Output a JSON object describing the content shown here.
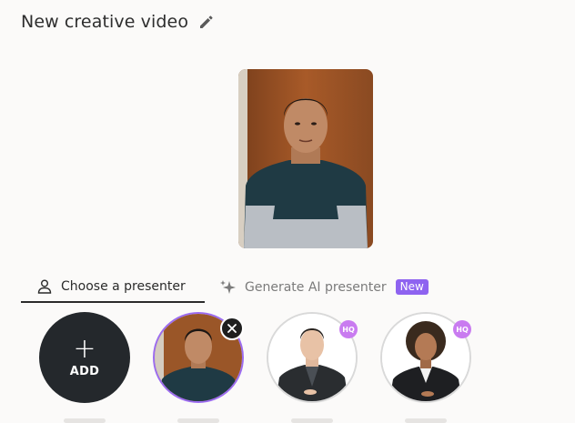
{
  "header": {
    "title": "New creative video",
    "edit_icon": "pencil-icon"
  },
  "preview": {
    "alt": "Selected presenter preview"
  },
  "tabs": [
    {
      "label": "Choose a presenter",
      "icon": "person-outline-icon",
      "active": true
    },
    {
      "label": "Generate AI presenter",
      "icon": "sparkles-icon",
      "badge": "New",
      "active": false
    }
  ],
  "presenters": {
    "add_label": "ADD",
    "items": [
      {
        "name": "custom-uploaded-presenter",
        "selected": true
      },
      {
        "name": "male-presenter-suit",
        "badge": "HQ"
      },
      {
        "name": "female-presenter-blazer",
        "badge": "HQ"
      }
    ]
  },
  "colors": {
    "accent": "#8e63f0",
    "hq_badge": "#c97bf0",
    "add_button": "#24282c"
  }
}
